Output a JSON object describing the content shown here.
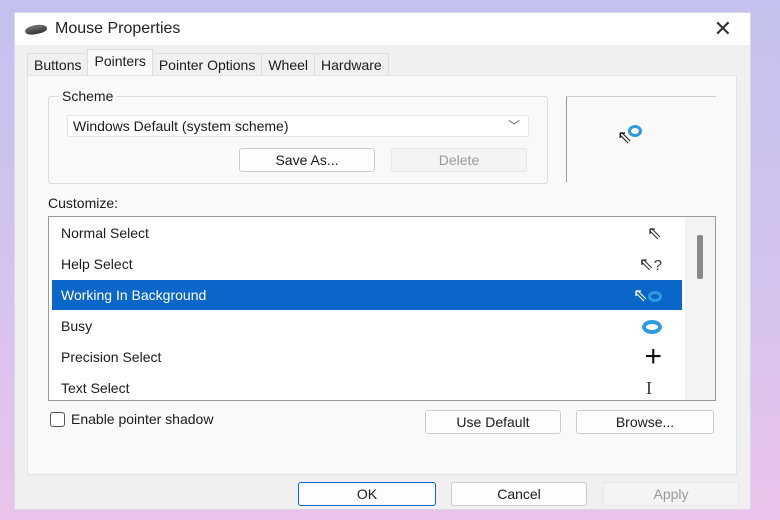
{
  "window": {
    "title": "Mouse Properties",
    "icon": "mouse-icon",
    "close_icon": "close-icon"
  },
  "tabs": [
    {
      "label": "Buttons"
    },
    {
      "label": "Pointers",
      "active": true
    },
    {
      "label": "Pointer Options"
    },
    {
      "label": "Wheel"
    },
    {
      "label": "Hardware"
    }
  ],
  "scheme": {
    "label": "Scheme",
    "value": "Windows Default (system scheme)",
    "save_as": "Save As...",
    "delete": "Delete"
  },
  "customize": {
    "label": "Customize:",
    "items": [
      {
        "label": "Normal Select",
        "icon": "arrow-cursor-icon"
      },
      {
        "label": "Help Select",
        "icon": "help-cursor-icon"
      },
      {
        "label": "Working In Background",
        "icon": "working-cursor-icon",
        "selected": true
      },
      {
        "label": "Busy",
        "icon": "busy-cursor-icon"
      },
      {
        "label": "Precision Select",
        "icon": "crosshair-cursor-icon"
      },
      {
        "label": "Text Select",
        "icon": "text-cursor-icon"
      }
    ]
  },
  "shadow": {
    "label": "Enable pointer shadow",
    "checked": false
  },
  "buttons": {
    "use_default": "Use Default",
    "browse": "Browse...",
    "ok": "OK",
    "cancel": "Cancel",
    "apply": "Apply"
  },
  "colors": {
    "selection": "#0a66c8",
    "busy_ring": "#2e9be0"
  }
}
